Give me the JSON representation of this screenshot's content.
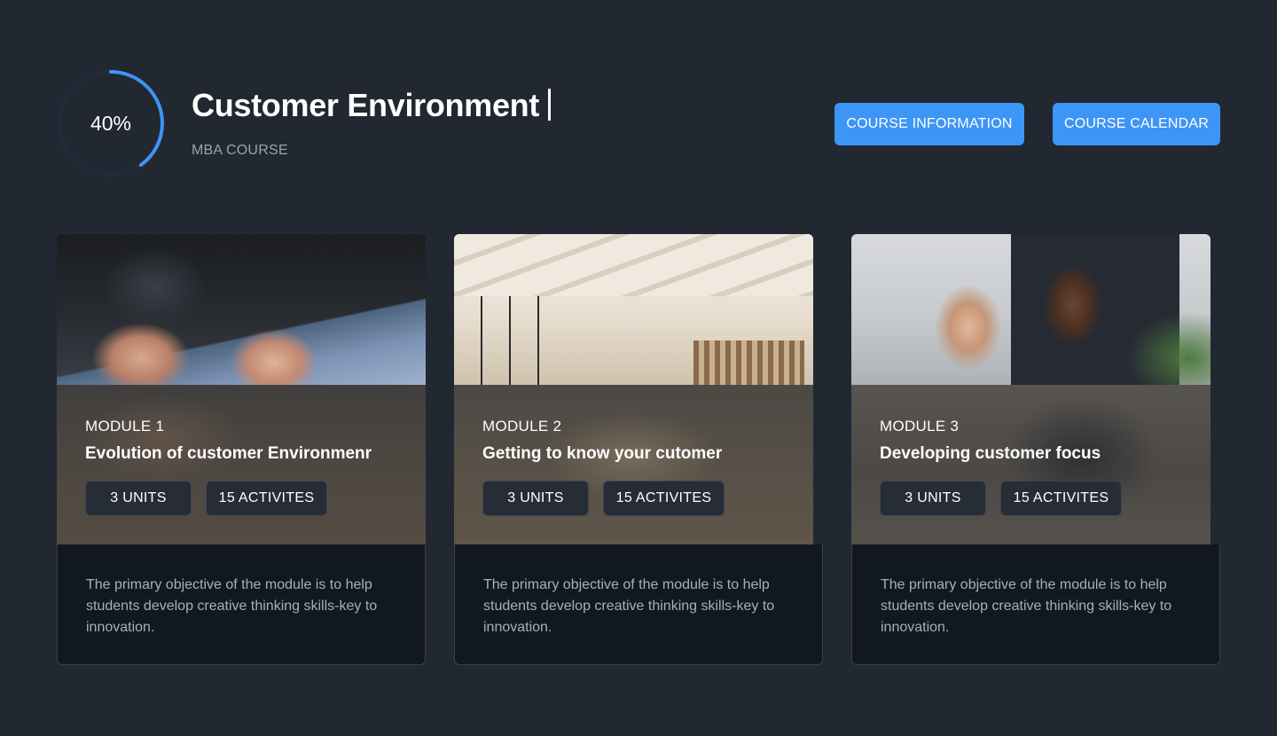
{
  "header": {
    "progress_text": "40%",
    "progress_fraction": 0.4,
    "title": "Customer Environment",
    "subtitle": "MBA COURSE",
    "buttons": {
      "course_information": "COURSE INFORMATION",
      "course_calendar": "COURSE CALENDAR"
    }
  },
  "colors": {
    "background": "#222831",
    "accent": "#3d95f5",
    "card_body": "#111820"
  },
  "modules": [
    {
      "label": "MODULE 1",
      "title": "Evolution of customer Environmenr",
      "units": "3 UNITS",
      "activities": "15 ACTIVITES",
      "description": "The primary objective of the module is to help students develop creative thinking skills-key to innovation."
    },
    {
      "label": "MODULE 2",
      "title": "Getting to know your cutomer",
      "units": "3 UNITS",
      "activities": "15 ACTIVITES",
      "description": "The primary objective of the module is to help students develop creative thinking skills-key to innovation."
    },
    {
      "label": "MODULE 3",
      "title": "Developing customer focus",
      "units": "3 UNITS",
      "activities": "15 ACTIVITES",
      "description": "The primary objective of the module is to help students develop creative thinking skills-key to innovation."
    }
  ]
}
